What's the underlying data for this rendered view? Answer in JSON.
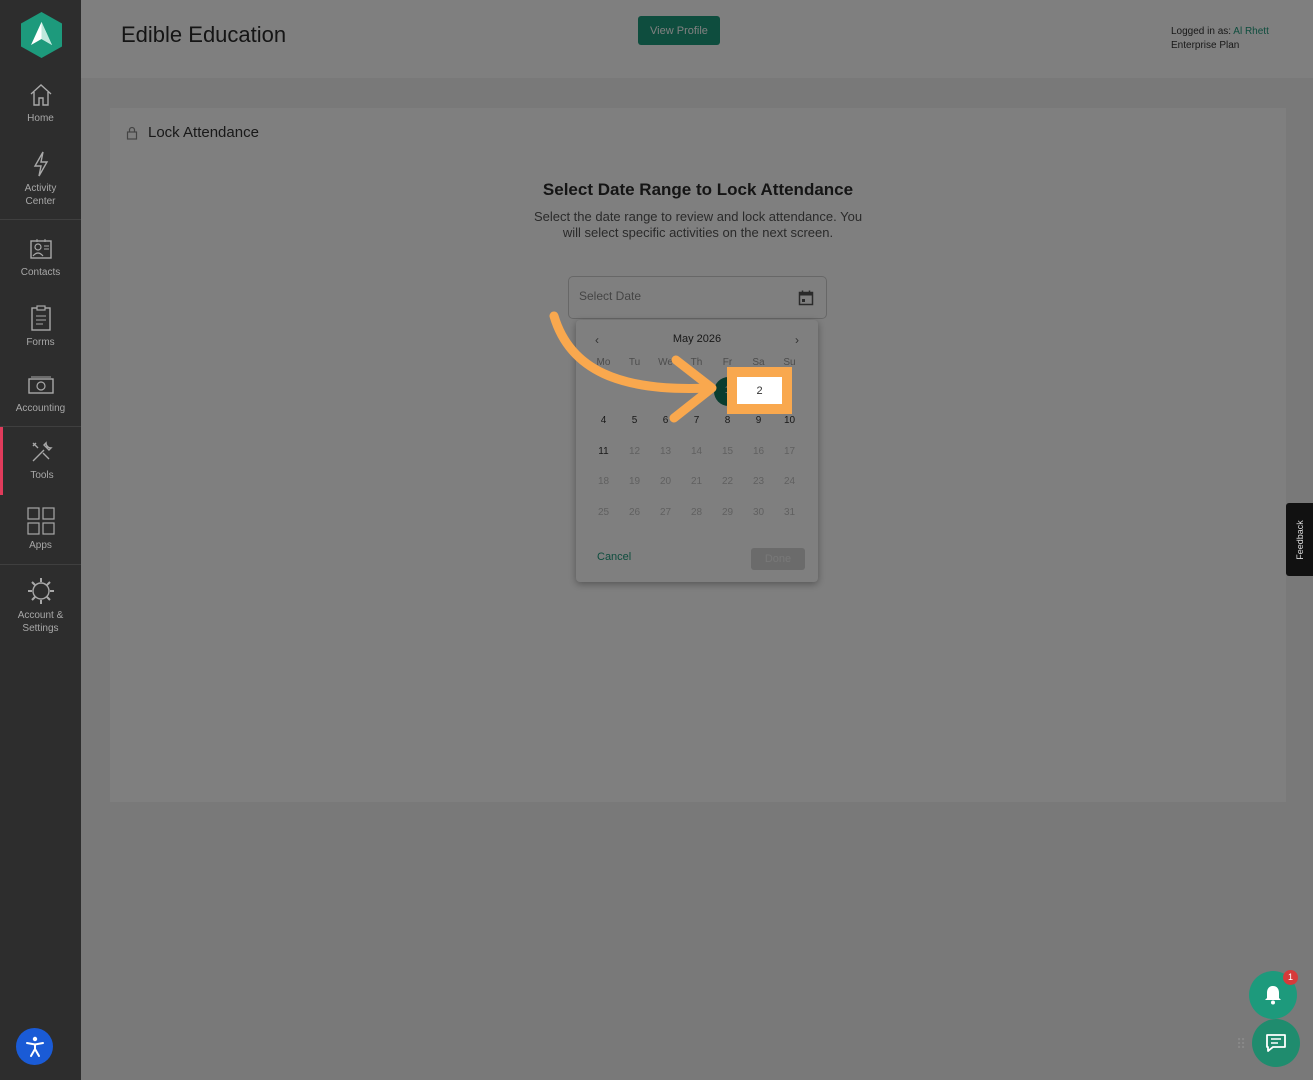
{
  "app": {
    "title": "Edible Education",
    "view_profile_label": "View Profile",
    "logged_in_prefix": "Logged in as: ",
    "user_name": "Al Rhett",
    "plan": "Enterprise Plan"
  },
  "sidebar": {
    "items": [
      {
        "label": "Home",
        "icon": "home-icon"
      },
      {
        "label": "Activity\nCenter",
        "icon": "lightning-icon"
      },
      {
        "label": "Contacts",
        "icon": "contacts-icon"
      },
      {
        "label": "Forms",
        "icon": "clipboard-icon"
      },
      {
        "label": "Accounting",
        "icon": "money-icon"
      },
      {
        "label": "Tools",
        "icon": "tools-icon",
        "active": true
      },
      {
        "label": "Apps",
        "icon": "apps-grid-icon"
      },
      {
        "label": "Account &\nSettings",
        "icon": "gear-icon"
      }
    ]
  },
  "section": {
    "title": "Lock Attendance"
  },
  "picker": {
    "heading": "Select Date Range to Lock Attendance",
    "description": "Select the date range to review and lock attendance. You will select specific activities on the next screen.",
    "placeholder": "Select Date"
  },
  "calendar": {
    "month": "May 2026",
    "prev": "‹",
    "next": "›",
    "weekdays": [
      "Mo",
      "Tu",
      "We",
      "Th",
      "Fr",
      "Sa",
      "Su"
    ],
    "week1": [
      "",
      "",
      "",
      "",
      "1",
      "2",
      "3"
    ],
    "week2": [
      "4",
      "5",
      "6",
      "7",
      "8",
      "9",
      "10"
    ],
    "week3": [
      "11",
      "12",
      "13",
      "14",
      "15",
      "16",
      "17"
    ],
    "week4": [
      "18",
      "19",
      "20",
      "21",
      "22",
      "23",
      "24"
    ],
    "week5": [
      "25",
      "26",
      "27",
      "28",
      "29",
      "30",
      "31"
    ],
    "selected_start": "1",
    "highlighted_day": "2",
    "cancel_label": "Cancel",
    "done_label": "Done"
  },
  "feedback_label": "Feedback",
  "notifications": {
    "count": "1"
  },
  "colors": {
    "brand_green": "#1d9a7c",
    "highlight_orange": "#f9a84e",
    "sidebar_bg": "#2d2d2d",
    "active_accent": "#e03b5b"
  }
}
